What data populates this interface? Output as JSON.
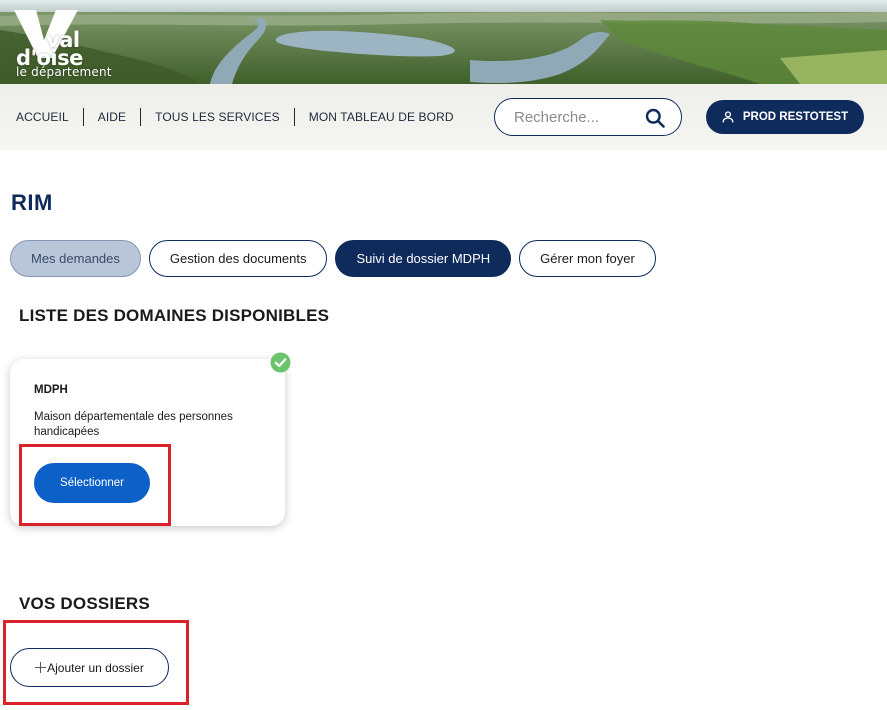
{
  "header": {
    "logo": {
      "line1": "val",
      "line2": "d'oise",
      "line3": "le département"
    },
    "nav": [
      {
        "label": "ACCUEIL"
      },
      {
        "label": "AIDE"
      },
      {
        "label": "TOUS LES SERVICES"
      },
      {
        "label": "MON TABLEAU DE BORD"
      }
    ],
    "search": {
      "placeholder": "Recherche...",
      "value": ""
    },
    "user_button": {
      "label": "PROD RESTOTEST"
    }
  },
  "page": {
    "title": "RIM",
    "tabs": [
      {
        "label": "Mes demandes",
        "state": "light"
      },
      {
        "label": "Gestion des documents",
        "state": "default"
      },
      {
        "label": "Suivi de dossier MDPH",
        "state": "active"
      },
      {
        "label": "Gérer mon foyer",
        "state": "default"
      }
    ],
    "domains_section": {
      "title": "LISTE DES DOMAINES DISPONIBLES",
      "cards": [
        {
          "title": "MDPH",
          "description": "Maison départementale des personnes handicapées",
          "button_label": "Sélectionner"
        }
      ]
    },
    "dossiers_section": {
      "title": "VOS DOSSIERS",
      "add_button_label": "Ajouter un dossier"
    }
  },
  "colors": {
    "navy": "#0f2b5c",
    "primary_blue": "#0e60c9",
    "highlight_red": "#d9222a",
    "check_green": "#6cc46f",
    "light_tab": "#b9c6da"
  }
}
